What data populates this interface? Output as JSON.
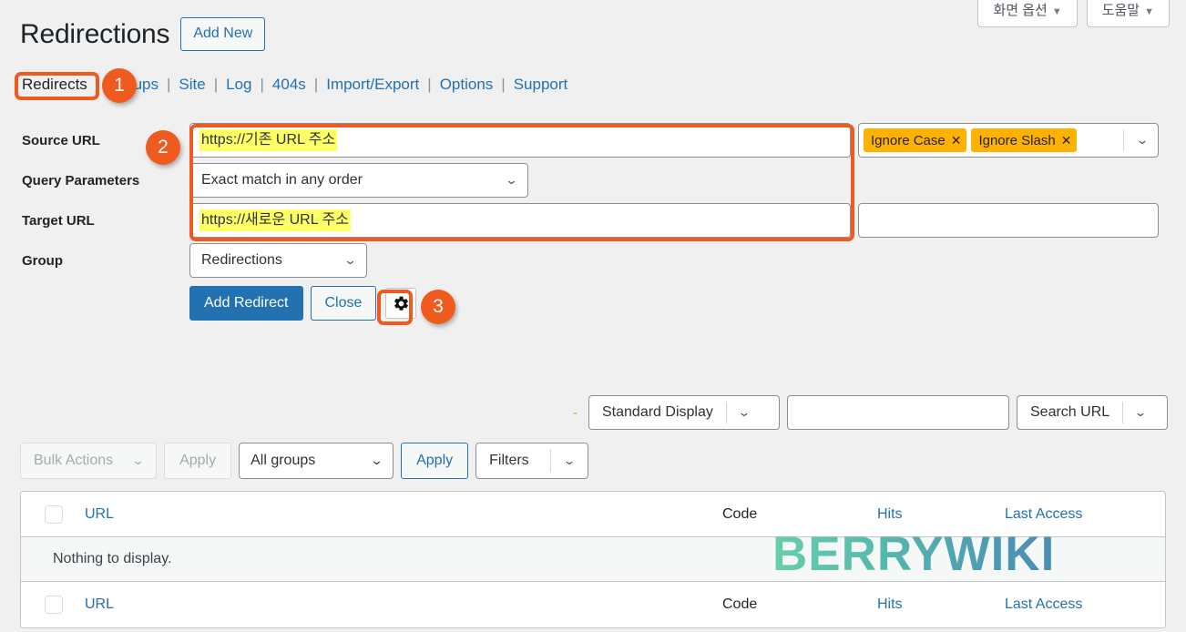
{
  "topbar": {
    "screen_options": "화면 옵션",
    "help": "도움말",
    "caret": "▼"
  },
  "header": {
    "title": "Redirections",
    "add_new_label": "Add New"
  },
  "subnav": {
    "items": [
      {
        "label": "Redirects",
        "current": true
      },
      {
        "label": "Groups",
        "current": false
      },
      {
        "label": "Site",
        "current": false
      },
      {
        "label": "Log",
        "current": false
      },
      {
        "label": "404s",
        "current": false
      },
      {
        "label": "Import/Export",
        "current": false
      },
      {
        "label": "Options",
        "current": false
      },
      {
        "label": "Support",
        "current": false
      }
    ],
    "separator": "|"
  },
  "annotations": {
    "badge1": "1",
    "badge2": "2",
    "badge3": "3",
    "highlight_color": "#ef5b1f"
  },
  "form": {
    "source_url": {
      "label": "Source URL",
      "value": "https://기존 URL 주소"
    },
    "query_parameters": {
      "label": "Query Parameters",
      "value": "Exact match in any order"
    },
    "target_url": {
      "label": "Target URL",
      "value": "https://새로운 URL 주소"
    },
    "group": {
      "label": "Group",
      "value": "Redirections"
    },
    "flags": {
      "chips": [
        {
          "label": "Ignore Case",
          "remove": "✕"
        },
        {
          "label": "Ignore Slash",
          "remove": "✕"
        }
      ],
      "chip_color": "#ffb100"
    },
    "title_field_value": "",
    "buttons": {
      "add_redirect": "Add Redirect",
      "close": "Close",
      "gear_icon": "gear-icon"
    }
  },
  "display_bar": {
    "dash": "-",
    "display_mode": "Standard Display",
    "search_value": "",
    "search_scope": "Search URL",
    "chevron": "⌄"
  },
  "toolbar": {
    "bulk_actions": "Bulk Actions",
    "bulk_apply": "Apply",
    "group_filter": "All groups",
    "group_apply": "Apply",
    "filters": "Filters",
    "chevron": "⌄"
  },
  "table": {
    "columns": {
      "url": "URL",
      "code": "Code",
      "hits": "Hits",
      "last_access": "Last Access"
    },
    "empty_message": "Nothing to display."
  },
  "watermark": {
    "text": "BERRYWIKI"
  }
}
